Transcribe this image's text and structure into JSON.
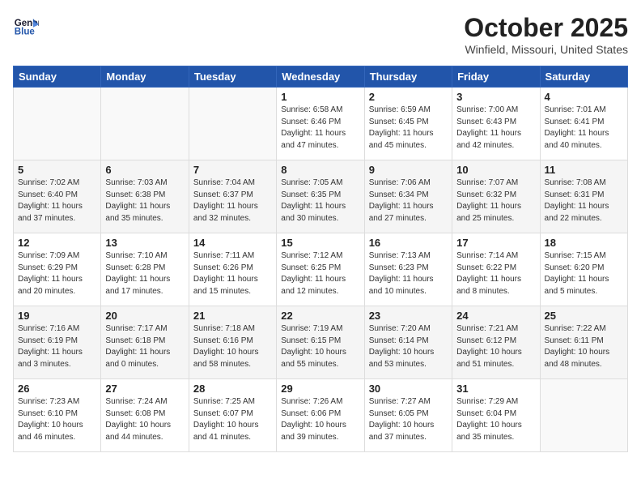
{
  "header": {
    "logo_line1": "General",
    "logo_line2": "Blue",
    "month": "October 2025",
    "location": "Winfield, Missouri, United States"
  },
  "weekdays": [
    "Sunday",
    "Monday",
    "Tuesday",
    "Wednesday",
    "Thursday",
    "Friday",
    "Saturday"
  ],
  "weeks": [
    [
      {
        "day": "",
        "info": ""
      },
      {
        "day": "",
        "info": ""
      },
      {
        "day": "",
        "info": ""
      },
      {
        "day": "1",
        "info": "Sunrise: 6:58 AM\nSunset: 6:46 PM\nDaylight: 11 hours\nand 47 minutes."
      },
      {
        "day": "2",
        "info": "Sunrise: 6:59 AM\nSunset: 6:45 PM\nDaylight: 11 hours\nand 45 minutes."
      },
      {
        "day": "3",
        "info": "Sunrise: 7:00 AM\nSunset: 6:43 PM\nDaylight: 11 hours\nand 42 minutes."
      },
      {
        "day": "4",
        "info": "Sunrise: 7:01 AM\nSunset: 6:41 PM\nDaylight: 11 hours\nand 40 minutes."
      }
    ],
    [
      {
        "day": "5",
        "info": "Sunrise: 7:02 AM\nSunset: 6:40 PM\nDaylight: 11 hours\nand 37 minutes."
      },
      {
        "day": "6",
        "info": "Sunrise: 7:03 AM\nSunset: 6:38 PM\nDaylight: 11 hours\nand 35 minutes."
      },
      {
        "day": "7",
        "info": "Sunrise: 7:04 AM\nSunset: 6:37 PM\nDaylight: 11 hours\nand 32 minutes."
      },
      {
        "day": "8",
        "info": "Sunrise: 7:05 AM\nSunset: 6:35 PM\nDaylight: 11 hours\nand 30 minutes."
      },
      {
        "day": "9",
        "info": "Sunrise: 7:06 AM\nSunset: 6:34 PM\nDaylight: 11 hours\nand 27 minutes."
      },
      {
        "day": "10",
        "info": "Sunrise: 7:07 AM\nSunset: 6:32 PM\nDaylight: 11 hours\nand 25 minutes."
      },
      {
        "day": "11",
        "info": "Sunrise: 7:08 AM\nSunset: 6:31 PM\nDaylight: 11 hours\nand 22 minutes."
      }
    ],
    [
      {
        "day": "12",
        "info": "Sunrise: 7:09 AM\nSunset: 6:29 PM\nDaylight: 11 hours\nand 20 minutes."
      },
      {
        "day": "13",
        "info": "Sunrise: 7:10 AM\nSunset: 6:28 PM\nDaylight: 11 hours\nand 17 minutes."
      },
      {
        "day": "14",
        "info": "Sunrise: 7:11 AM\nSunset: 6:26 PM\nDaylight: 11 hours\nand 15 minutes."
      },
      {
        "day": "15",
        "info": "Sunrise: 7:12 AM\nSunset: 6:25 PM\nDaylight: 11 hours\nand 12 minutes."
      },
      {
        "day": "16",
        "info": "Sunrise: 7:13 AM\nSunset: 6:23 PM\nDaylight: 11 hours\nand 10 minutes."
      },
      {
        "day": "17",
        "info": "Sunrise: 7:14 AM\nSunset: 6:22 PM\nDaylight: 11 hours\nand 8 minutes."
      },
      {
        "day": "18",
        "info": "Sunrise: 7:15 AM\nSunset: 6:20 PM\nDaylight: 11 hours\nand 5 minutes."
      }
    ],
    [
      {
        "day": "19",
        "info": "Sunrise: 7:16 AM\nSunset: 6:19 PM\nDaylight: 11 hours\nand 3 minutes."
      },
      {
        "day": "20",
        "info": "Sunrise: 7:17 AM\nSunset: 6:18 PM\nDaylight: 11 hours\nand 0 minutes."
      },
      {
        "day": "21",
        "info": "Sunrise: 7:18 AM\nSunset: 6:16 PM\nDaylight: 10 hours\nand 58 minutes."
      },
      {
        "day": "22",
        "info": "Sunrise: 7:19 AM\nSunset: 6:15 PM\nDaylight: 10 hours\nand 55 minutes."
      },
      {
        "day": "23",
        "info": "Sunrise: 7:20 AM\nSunset: 6:14 PM\nDaylight: 10 hours\nand 53 minutes."
      },
      {
        "day": "24",
        "info": "Sunrise: 7:21 AM\nSunset: 6:12 PM\nDaylight: 10 hours\nand 51 minutes."
      },
      {
        "day": "25",
        "info": "Sunrise: 7:22 AM\nSunset: 6:11 PM\nDaylight: 10 hours\nand 48 minutes."
      }
    ],
    [
      {
        "day": "26",
        "info": "Sunrise: 7:23 AM\nSunset: 6:10 PM\nDaylight: 10 hours\nand 46 minutes."
      },
      {
        "day": "27",
        "info": "Sunrise: 7:24 AM\nSunset: 6:08 PM\nDaylight: 10 hours\nand 44 minutes."
      },
      {
        "day": "28",
        "info": "Sunrise: 7:25 AM\nSunset: 6:07 PM\nDaylight: 10 hours\nand 41 minutes."
      },
      {
        "day": "29",
        "info": "Sunrise: 7:26 AM\nSunset: 6:06 PM\nDaylight: 10 hours\nand 39 minutes."
      },
      {
        "day": "30",
        "info": "Sunrise: 7:27 AM\nSunset: 6:05 PM\nDaylight: 10 hours\nand 37 minutes."
      },
      {
        "day": "31",
        "info": "Sunrise: 7:29 AM\nSunset: 6:04 PM\nDaylight: 10 hours\nand 35 minutes."
      },
      {
        "day": "",
        "info": ""
      }
    ]
  ]
}
